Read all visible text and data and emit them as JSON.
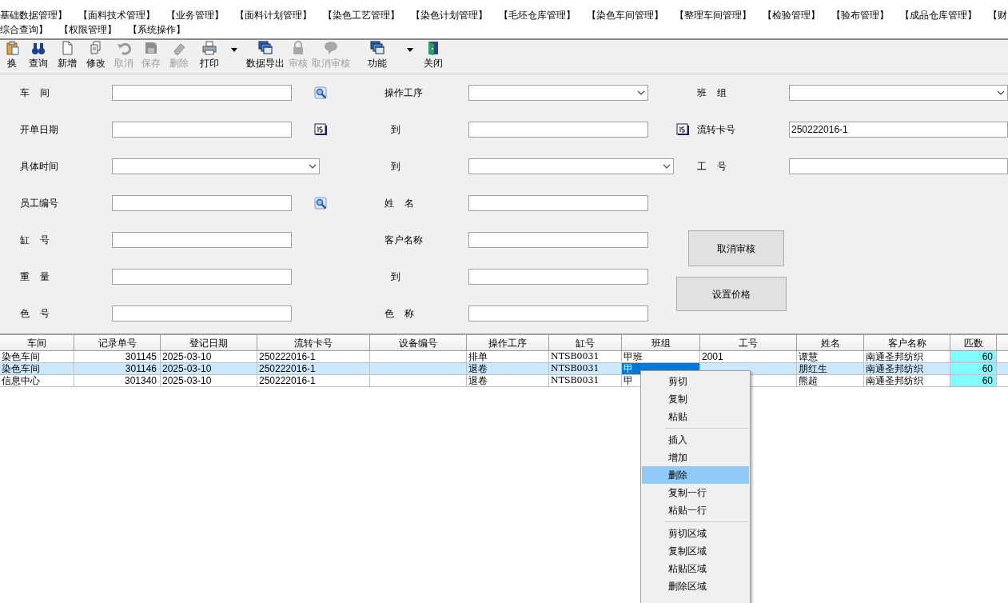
{
  "menu_bar": [
    [
      "基础数据管理】",
      "【面料技术管理】",
      "【业务管理】",
      "【面料计划管理】",
      "【染色工艺管理】",
      "【染色计划管理】",
      "【毛坯仓库管理】",
      "【染色车间管理】",
      "【整理车间管理】",
      "【检验管理】",
      "【验布管理】",
      "【成品仓库管理】",
      "【财"
    ],
    [
      "综合查询】",
      "【权限管理】",
      "【系统操作】"
    ]
  ],
  "toolbar": [
    {
      "kind": "button",
      "label": "换",
      "disabled": false
    },
    {
      "kind": "button",
      "label": "查询",
      "disabled": false
    },
    {
      "kind": "button",
      "label": "新增",
      "disabled": false
    },
    {
      "kind": "button",
      "label": "修改",
      "disabled": false
    },
    {
      "kind": "button",
      "label": "取消",
      "disabled": true
    },
    {
      "kind": "button",
      "label": "保存",
      "disabled": true
    },
    {
      "kind": "button",
      "label": "删除",
      "disabled": true
    },
    {
      "kind": "button",
      "label": "打印",
      "disabled": false
    },
    {
      "kind": "dropdown"
    },
    {
      "kind": "button",
      "label": "数据导出",
      "disabled": false
    },
    {
      "kind": "button",
      "label": "审核",
      "disabled": true
    },
    {
      "kind": "button",
      "label": "取消审核",
      "disabled": true
    },
    {
      "kind": "button",
      "label": "功能",
      "disabled": false
    },
    {
      "kind": "dropdown"
    },
    {
      "kind": "button",
      "label": "关闭",
      "disabled": false
    }
  ],
  "form": {
    "left": [
      {
        "label": "车    间",
        "kind": "text",
        "lookup_button": true,
        "calendar_button": false
      },
      {
        "label": "开单日期",
        "kind": "text",
        "lookup_button": false,
        "calendar_button": true
      },
      {
        "label": "具体时间",
        "kind": "select",
        "lookup_button": false,
        "calendar_button": false
      },
      {
        "label": "员工编号",
        "kind": "text",
        "lookup_button": true,
        "calendar_button": false
      },
      {
        "label": "缸    号",
        "kind": "text",
        "lookup_button": false,
        "calendar_button": false
      },
      {
        "label": "重    量",
        "kind": "text",
        "lookup_button": false,
        "calendar_button": false
      },
      {
        "label": "色    号",
        "kind": "text",
        "lookup_button": false,
        "calendar_button": false
      }
    ],
    "middle": [
      {
        "label": "操作工序",
        "kind": "select",
        "lookup_button": false,
        "calendar_button": false
      },
      {
        "label": "到",
        "kind": "text",
        "lookup_button": false,
        "calendar_button": true
      },
      {
        "label": "到",
        "kind": "select",
        "lookup_button": false,
        "calendar_button": false
      },
      {
        "label": "姓    名",
        "kind": "text",
        "lookup_button": false,
        "calendar_button": false
      },
      {
        "label": "客户名称",
        "kind": "text",
        "lookup_button": false,
        "calendar_button": false
      },
      {
        "label": "到",
        "kind": "text",
        "lookup_button": false,
        "calendar_button": false
      },
      {
        "label": "色    称",
        "kind": "text",
        "lookup_button": false,
        "calendar_button": false
      }
    ],
    "right": [
      {
        "label": "班    组",
        "kind": "select"
      },
      {
        "label": "流转卡号",
        "kind": "text",
        "value": "250222016-1"
      },
      {
        "label": "工    号",
        "kind": "text"
      }
    ],
    "buttons": [
      "取消审核",
      "设置价格"
    ]
  },
  "table": {
    "columns": [
      {
        "label": "车间",
        "tinted": false
      },
      {
        "label": "记录单号",
        "tinted": false
      },
      {
        "label": "登记日期",
        "tinted": false
      },
      {
        "label": "流转卡号",
        "tinted": false
      },
      {
        "label": "设备编号",
        "tinted": false
      },
      {
        "label": "操作工序",
        "tinted": false
      },
      {
        "label": "缸号",
        "tinted": false
      },
      {
        "label": "班组",
        "tinted": false
      },
      {
        "label": "工号",
        "tinted": false
      },
      {
        "label": "姓名",
        "tinted": false
      },
      {
        "label": "客户名称",
        "tinted": false
      },
      {
        "label": "匹数",
        "tinted": true
      }
    ],
    "rows": [
      {
        "selected": false,
        "cells": [
          {
            "text": "染色车间",
            "focused": false
          },
          {
            "text": "301145",
            "focused": false
          },
          {
            "text": "2025-03-10",
            "focused": false
          },
          {
            "text": "250222016-1",
            "focused": false
          },
          {
            "focused": false
          },
          {
            "text": "排单",
            "focused": false
          },
          {
            "text": "NTSB0031",
            "focused": false
          },
          {
            "text": "甲班",
            "focused": false
          },
          {
            "text": "2001",
            "focused": false
          },
          {
            "text": "谭慧",
            "focused": false
          },
          {
            "text": "南通圣邦纺织",
            "focused": false
          },
          {
            "text": "60",
            "focused": false
          }
        ]
      },
      {
        "selected": true,
        "cells": [
          {
            "text": "染色车间",
            "focused": false
          },
          {
            "text": "301146",
            "focused": false
          },
          {
            "text": "2025-03-10",
            "focused": false
          },
          {
            "text": "250222016-1",
            "focused": false
          },
          {
            "focused": false
          },
          {
            "text": "退卷",
            "focused": false
          },
          {
            "text": "NTSB0031",
            "focused": false
          },
          {
            "text": "甲",
            "focused": true
          },
          {
            "focused": false
          },
          {
            "text": "朋红生",
            "focused": false
          },
          {
            "text": "南通圣邦纺织",
            "focused": false
          },
          {
            "text": "60",
            "focused": false
          }
        ]
      },
      {
        "selected": false,
        "cells": [
          {
            "text": "信息中心",
            "focused": false
          },
          {
            "text": "301340",
            "focused": false
          },
          {
            "text": "2025-03-10",
            "focused": false
          },
          {
            "text": "250222016-1",
            "focused": false
          },
          {
            "focused": false
          },
          {
            "text": "退卷",
            "focused": false
          },
          {
            "text": "NTSB0031",
            "focused": false
          },
          {
            "text": "甲",
            "focused": false
          },
          {
            "focused": false
          },
          {
            "text": "熊超",
            "focused": false
          },
          {
            "text": "南通圣邦纺织",
            "focused": false
          },
          {
            "text": "60",
            "focused": false
          }
        ]
      }
    ]
  },
  "context_menu": [
    {
      "kind": "item",
      "label": "剪切",
      "selected": false
    },
    {
      "kind": "item",
      "label": "复制",
      "selected": false
    },
    {
      "kind": "item",
      "label": "粘贴",
      "selected": false
    },
    {
      "kind": "separator"
    },
    {
      "kind": "item",
      "label": "插入",
      "selected": false
    },
    {
      "kind": "item",
      "label": "增加",
      "selected": false
    },
    {
      "kind": "item",
      "label": "删除",
      "selected": true
    },
    {
      "kind": "item",
      "label": "复制一行",
      "selected": false
    },
    {
      "kind": "item",
      "label": "粘贴一行",
      "selected": false
    },
    {
      "kind": "separator"
    },
    {
      "kind": "item",
      "label": "剪切区域",
      "selected": false
    },
    {
      "kind": "item",
      "label": "复制区域",
      "selected": false
    },
    {
      "kind": "item",
      "label": "粘贴区域",
      "selected": false
    },
    {
      "kind": "item",
      "label": "删除区域",
      "selected": false
    }
  ]
}
